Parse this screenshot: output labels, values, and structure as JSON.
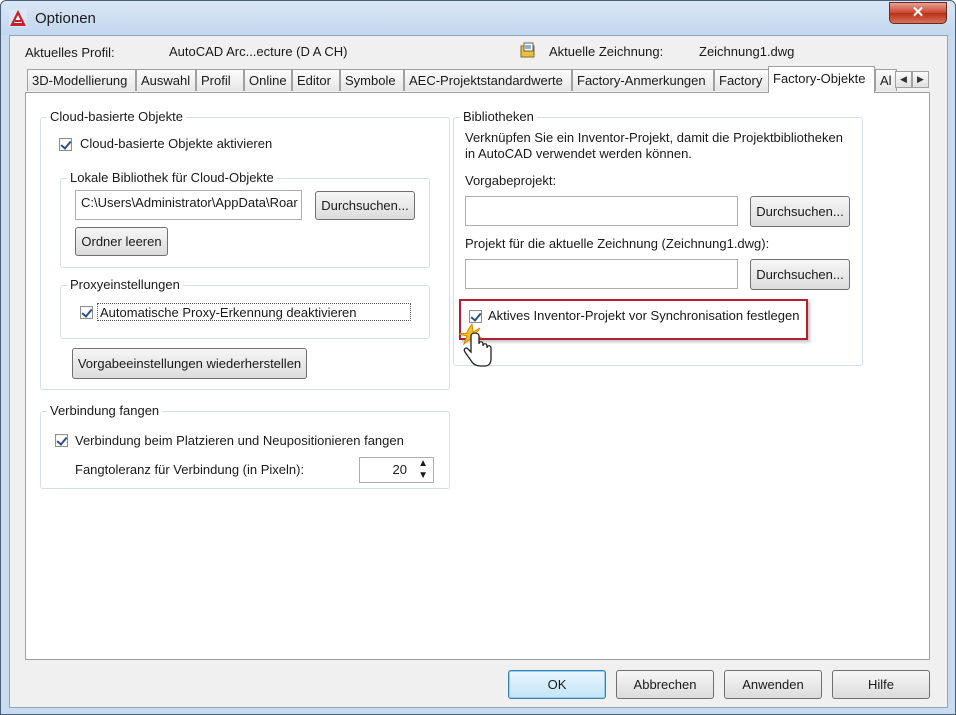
{
  "window": {
    "title": "Optionen",
    "close_label": "✕",
    "accent_color": "#b02030"
  },
  "header": {
    "profile_label": "Aktuelles Profil:",
    "profile_value": "AutoCAD Arc...ecture (D A CH)",
    "drawing_label": "Aktuelle Zeichnung:",
    "drawing_value": "Zeichnung1.dwg"
  },
  "tabs": [
    {
      "label": "3D-Modellierung"
    },
    {
      "label": "Auswahl"
    },
    {
      "label": "Profil"
    },
    {
      "label": "Online"
    },
    {
      "label": "Editor"
    },
    {
      "label": "Symbole"
    },
    {
      "label": "AEC-Projektstandardwerte"
    },
    {
      "label": "Factory-Anmerkungen"
    },
    {
      "label": "Factory"
    },
    {
      "label": "Factory-Objekte",
      "active": true
    },
    {
      "label": "Al"
    }
  ],
  "cloud": {
    "group_title": "Cloud-basierte Objekte",
    "enable_label": "Cloud-basierte Objekte aktivieren",
    "enable_checked": true,
    "library": {
      "group_title": "Lokale Bibliothek für Cloud-Objekte",
      "path_value": "C:\\Users\\Administrator\\AppData\\Roar",
      "browse_label": "Durchsuchen...",
      "clear_label": "Ordner leeren"
    },
    "proxy": {
      "group_title": "Proxyeinstellungen",
      "auto_detect_label": "Automatische Proxy-Erkennung deaktivieren",
      "auto_detect_checked": true
    },
    "restore_label": "Vorgabeeinstellungen wiederherstellen"
  },
  "snap": {
    "group_title": "Verbindung fangen",
    "snap_label": "Verbindung beim Platzieren und Neupositionieren fangen",
    "snap_checked": true,
    "tolerance_label": "Fangtoleranz für Verbindung (in Pixeln):",
    "tolerance_value": "20"
  },
  "libraries": {
    "group_title": "Bibliotheken",
    "description_line1": "Verknüpfen Sie ein Inventor-Projekt, damit die Projektbibliotheken",
    "description_line2": "in AutoCAD verwendet werden können.",
    "default_project_label": "Vorgabeprojekt:",
    "default_project_value": "",
    "browse_label_1": "Durchsuchen...",
    "current_project_label": "Projekt für die aktuelle Zeichnung (Zeichnung1.dwg):",
    "current_project_value": "",
    "browse_label_2": "Durchsuchen...",
    "active_project_label": "Aktives Inventor-Projekt vor Synchronisation festlegen",
    "active_project_checked": true
  },
  "footer": {
    "ok_label": "OK",
    "cancel_label": "Abbrechen",
    "apply_label": "Anwenden",
    "help_label": "Hilfe"
  }
}
